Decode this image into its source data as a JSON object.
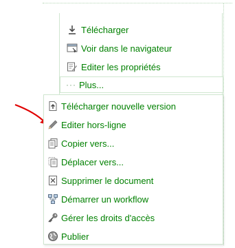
{
  "actions": {
    "download_label": "Télécharger",
    "view_browser_label": "Voir dans le navigateur",
    "edit_props_label": "Editer les propriétés",
    "more_label": "Plus..."
  },
  "menu": {
    "items": [
      {
        "label": "Télécharger nouvelle version",
        "icon": "upload-new-version-icon"
      },
      {
        "label": "Editer hors-ligne",
        "icon": "pencil-icon"
      },
      {
        "label": "Copier vers...",
        "icon": "copy-icon"
      },
      {
        "label": "Déplacer vers...",
        "icon": "move-icon"
      },
      {
        "label": "Supprimer le document",
        "icon": "delete-document-icon"
      },
      {
        "label": "Démarrer un workflow",
        "icon": "workflow-icon"
      },
      {
        "label": "Gérer les droits d'accès",
        "icon": "key-icon"
      },
      {
        "label": "Publier",
        "icon": "publish-icon"
      }
    ]
  },
  "colors": {
    "link_green": "#008000",
    "border_green": "#cfe6cf",
    "arrow_red": "#e00000"
  }
}
